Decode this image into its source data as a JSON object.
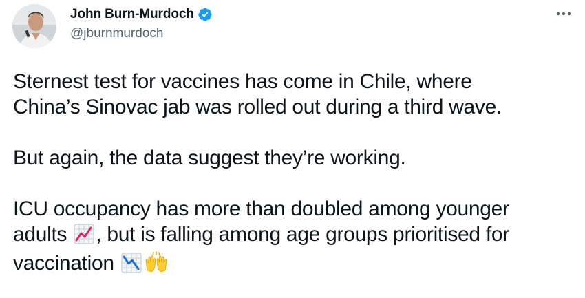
{
  "author": {
    "display_name": "John Burn-Murdoch",
    "handle": "@jburnmurdoch",
    "verified": true
  },
  "tweet": {
    "para1_line1": "Sternest test for vaccines has come in Chile, where",
    "para1_line2": "China’s Sinovac jab was rolled out during a third wave.",
    "para2": "But again, the data suggest they’re working.",
    "para3_line1": "ICU occupancy has more than doubled among younger",
    "para3_line2_a": "adults",
    "para3_line2_b": ", but is falling among age groups prioritised for",
    "para3_line3": "vaccination"
  },
  "icons": {
    "more": "more-options-icon",
    "verified": "verified-badge-icon",
    "emoji1": "chart-increasing-emoji",
    "emoji2": "chart-decreasing-emoji",
    "emoji3": "raising-hands-emoji"
  },
  "colors": {
    "text": "#0f1419",
    "secondary": "#536471",
    "verified_blue": "#1d9bf0"
  }
}
